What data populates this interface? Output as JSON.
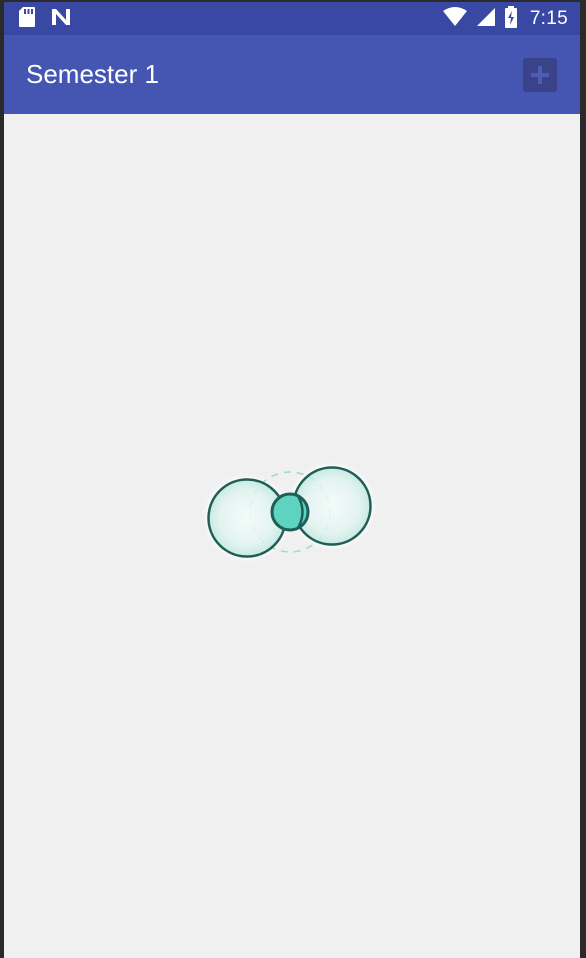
{
  "status_bar": {
    "time": "7:15",
    "icons": [
      "sd-card-icon",
      "n-notification-icon",
      "wifi-icon",
      "cell-signal-icon",
      "battery-charging-icon"
    ]
  },
  "app_bar": {
    "title": "Semester 1",
    "add_button_icon": "plus-icon"
  },
  "content": {
    "state": "loading",
    "loader_icon": "loading-spinner-icon"
  },
  "colors": {
    "status_bar": "#3949a3",
    "app_bar": "#4556b2",
    "add_button": "#3a4289",
    "background": "#f0f0f0",
    "loader_stroke": "#1f5e57",
    "loader_fill": "#5ed3c0"
  }
}
